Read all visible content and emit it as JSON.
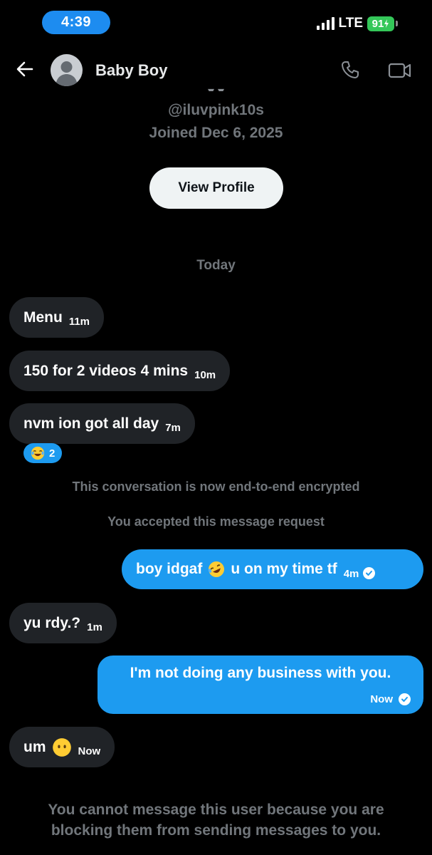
{
  "status_bar": {
    "time": "4:39",
    "network": "LTE",
    "battery": "91"
  },
  "header": {
    "contact_name": "Baby Boy"
  },
  "profile": {
    "handle": "@iluvpink10s",
    "joined": "Joined Dec 6, 2025",
    "view_profile_label": "View Profile"
  },
  "day_separator": "Today",
  "messages": [
    {
      "direction": "in",
      "text": "Menu",
      "time": "11m"
    },
    {
      "direction": "in",
      "text": "150 for 2 videos 4 mins",
      "time": "10m"
    },
    {
      "direction": "in",
      "text": "nvm ion got all day",
      "time": "7m",
      "reaction": {
        "emoji": "face-with-tears-of-joy",
        "count": "2"
      }
    },
    {
      "direction": "out",
      "text_before": "boy idgaf",
      "emoji": "rolling-on-floor-laughing",
      "text_after": "u on my time tf",
      "time": "4m"
    },
    {
      "direction": "in",
      "text": "yu rdy.?",
      "time": "1m"
    },
    {
      "direction": "out",
      "text": "I'm not doing any business with you.",
      "time": "Now"
    },
    {
      "direction": "in",
      "text": "um",
      "emoji": "face-without-mouth",
      "time": "Now"
    }
  ],
  "system_notices": [
    "This conversation is now end-to-end encrypted",
    "You accepted this message request"
  ],
  "blocked_notice": "You cannot message this user because you are blocking them from sending messages to you.",
  "colors": {
    "accent": "#1d9bf0",
    "incoming_bubble": "#202327",
    "muted_text": "#71767b",
    "background": "#000000"
  }
}
